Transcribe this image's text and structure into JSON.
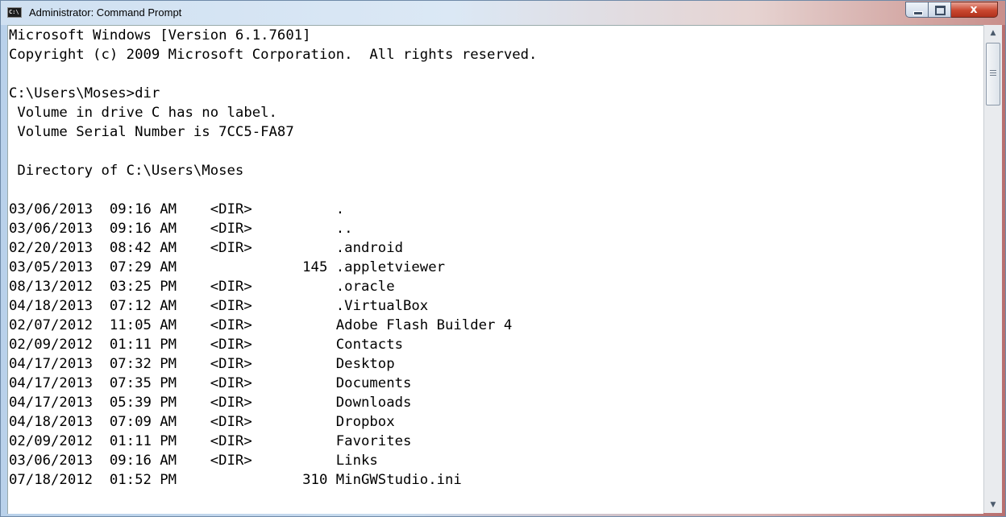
{
  "window": {
    "title": "Administrator: Command Prompt",
    "icon_text": "C:\\",
    "close_glyph": "x"
  },
  "console": {
    "lines": [
      "Microsoft Windows [Version 6.1.7601]",
      "Copyright (c) 2009 Microsoft Corporation.  All rights reserved.",
      "",
      "C:\\Users\\Moses>dir",
      " Volume in drive C has no label.",
      " Volume Serial Number is 7CC5-FA87",
      "",
      " Directory of C:\\Users\\Moses",
      "",
      "03/06/2013  09:16 AM    <DIR>          .",
      "03/06/2013  09:16 AM    <DIR>          ..",
      "02/20/2013  08:42 AM    <DIR>          .android",
      "03/05/2013  07:29 AM               145 .appletviewer",
      "08/13/2012  03:25 PM    <DIR>          .oracle",
      "04/18/2013  07:12 AM    <DIR>          .VirtualBox",
      "02/07/2012  11:05 AM    <DIR>          Adobe Flash Builder 4",
      "02/09/2012  01:11 PM    <DIR>          Contacts",
      "04/17/2013  07:32 PM    <DIR>          Desktop",
      "04/17/2013  07:35 PM    <DIR>          Documents",
      "04/17/2013  05:39 PM    <DIR>          Downloads",
      "04/18/2013  07:09 AM    <DIR>          Dropbox",
      "02/09/2012  01:11 PM    <DIR>          Favorites",
      "03/06/2013  09:16 AM    <DIR>          Links",
      "07/18/2012  01:52 PM               310 MinGWStudio.ini"
    ]
  },
  "scrollbar": {
    "up_glyph": "▲",
    "down_glyph": "▼"
  }
}
